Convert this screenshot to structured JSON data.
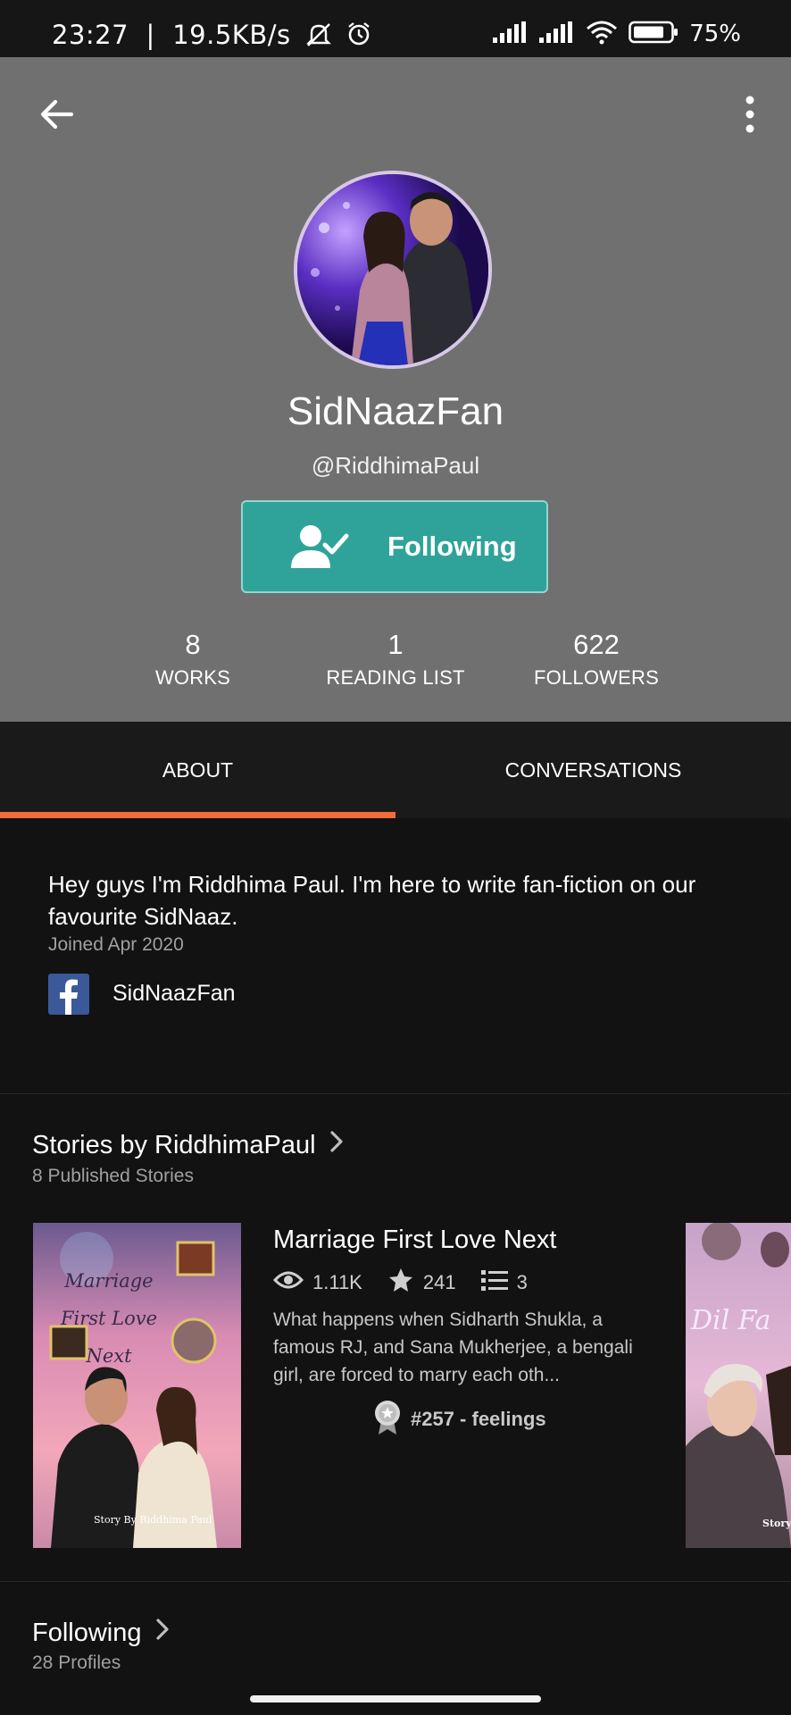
{
  "status_bar": {
    "time": "23:27",
    "net_speed": "19.5KB/s",
    "battery": "75%",
    "icons": [
      "mute-icon",
      "alarm-icon",
      "signal-icon",
      "signal-icon",
      "wifi-icon",
      "battery-icon"
    ]
  },
  "header": {
    "back_icon": "arrow-left-icon",
    "more_icon": "more-vertical-icon",
    "name": "SidNaazFan",
    "handle": "@RiddhimaPaul",
    "follow_label": "Following",
    "follow_icon": "user-check-icon",
    "bg_color": "#707070",
    "accent_color": "#2fa39a"
  },
  "stats": [
    {
      "value": "8",
      "label": "WORKS"
    },
    {
      "value": "1",
      "label": "READING LIST"
    },
    {
      "value": "622",
      "label": "FOLLOWERS"
    }
  ],
  "tabs": [
    {
      "label": "ABOUT",
      "active": true
    },
    {
      "label": "CONVERSATIONS",
      "active": false
    }
  ],
  "about": {
    "bio": "Hey guys I'm Riddhima Paul. I'm here to write fan-fiction on our favourite SidNaaz.",
    "joined": "Joined Apr 2020",
    "facebook_name": "SidNaazFan",
    "facebook_icon": "facebook-icon"
  },
  "stories_section": {
    "title": "Stories by RiddhimaPaul",
    "subtitle": "8 Published Stories",
    "stories": [
      {
        "title": "Marriage First Love Next",
        "cover_title": "Marriage First Love Next",
        "cover_credit": "Story By Riddhima Paul",
        "reads": "1.11K",
        "votes": "241",
        "parts": "3",
        "description": "What happens when Sidharth Shukla, a famous RJ, and Sana Mukherjee, a bengali girl, are forced to marry each oth...",
        "rank": "#257 - feelings"
      }
    ],
    "next_cover_title": "Dil Fa",
    "next_cover_credit": "Story"
  },
  "following_section": {
    "title": "Following",
    "subtitle": "28 Profiles"
  },
  "colors": {
    "tab_indicator": "#f26b3a",
    "facebook_blue": "#3b5998"
  }
}
